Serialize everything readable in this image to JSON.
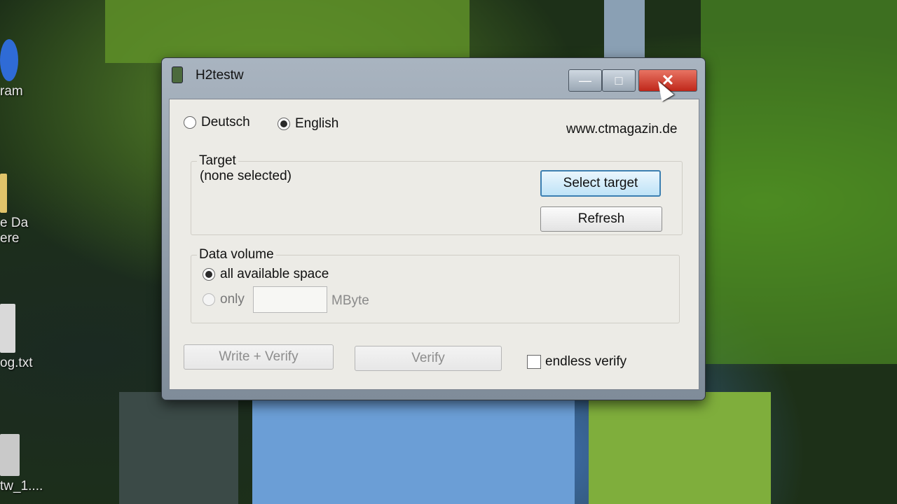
{
  "desktop": {
    "icons": [
      {
        "label": "ram",
        "icon": "program-icon"
      },
      {
        "label": "e Da\nere",
        "icon": "folder-icon"
      },
      {
        "label": "og.txt",
        "icon": "text-file-icon"
      },
      {
        "label": "tw_1....",
        "icon": "archive-file-icon"
      }
    ]
  },
  "window": {
    "title": "H2testw",
    "controls": {
      "minimize": "—",
      "maximize": "□",
      "close": "✕"
    }
  },
  "language": {
    "options": [
      {
        "label": "Deutsch",
        "selected": false
      },
      {
        "label": "English",
        "selected": true
      }
    ],
    "website": "www.ctmagazin.de"
  },
  "target": {
    "group_label": "Target",
    "status": "(none selected)",
    "select_button": "Select target",
    "refresh_button": "Refresh"
  },
  "data_volume": {
    "group_label": "Data volume",
    "option_all": "all available space",
    "option_only": "only",
    "only_value": "",
    "unit": "MByte"
  },
  "actions": {
    "write_verify": "Write + Verify",
    "verify": "Verify",
    "endless_verify": "endless verify",
    "endless_checked": false
  }
}
